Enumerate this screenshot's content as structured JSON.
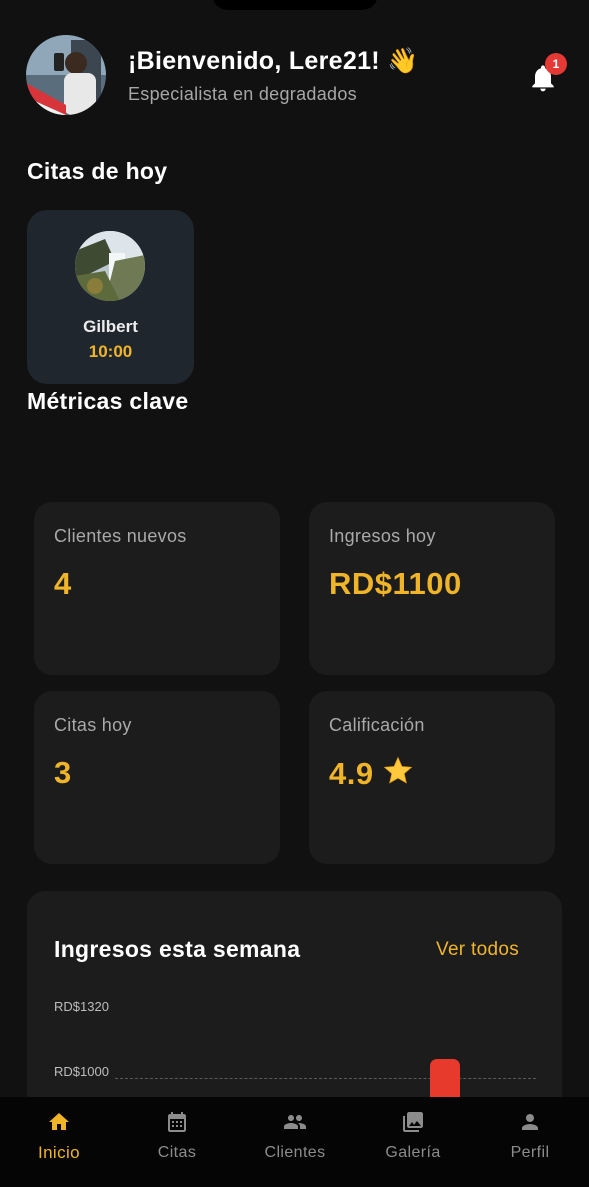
{
  "header": {
    "greeting": "¡Bienvenido, Lere21! 👋",
    "subtitle": "Especialista en degradados",
    "notification_count": "1"
  },
  "today": {
    "title": "Citas de hoy",
    "appointments": [
      {
        "name": "Gilbert",
        "time": "10:00"
      }
    ]
  },
  "metrics": {
    "title": "Métricas clave",
    "items": [
      {
        "label": "Clientes nuevos",
        "value": "4"
      },
      {
        "label": "Ingresos hoy",
        "value": "RD$1100"
      },
      {
        "label": "Citas hoy",
        "value": "3"
      },
      {
        "label": "Calificación",
        "value": "4.9"
      }
    ]
  },
  "weekly": {
    "title": "Ingresos esta semana",
    "link": "Ver todos",
    "y_labels": [
      "RD$1320",
      "RD$1000"
    ]
  },
  "chart_data": {
    "type": "bar",
    "title": "Ingresos esta semana",
    "y_ticks": [
      1320,
      1000
    ],
    "highlight_bar_value": 1100
  },
  "nav": {
    "items": [
      {
        "label": "Inicio",
        "icon": "home-icon",
        "active": true
      },
      {
        "label": "Citas",
        "icon": "calendar-icon",
        "active": false
      },
      {
        "label": "Clientes",
        "icon": "people-icon",
        "active": false
      },
      {
        "label": "Galería",
        "icon": "gallery-icon",
        "active": false
      },
      {
        "label": "Perfil",
        "icon": "person-icon",
        "active": false
      }
    ]
  },
  "colors": {
    "background": "#111111",
    "card": "#1c1c1c",
    "accent": "#f0b429",
    "badge": "#e53935",
    "bar": "#e8392d"
  }
}
